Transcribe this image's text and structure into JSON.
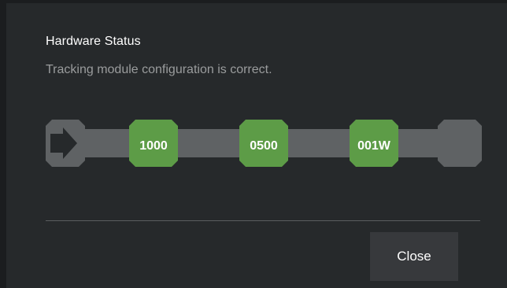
{
  "dialog": {
    "title": "Hardware Status",
    "message": "Tracking module configuration is correct.",
    "close_label": "Close"
  },
  "chain": {
    "track_color": "#5f6264",
    "module_color": "#5d9c47",
    "arrow_icon": "arrow-right-icon",
    "modules": [
      {
        "label": "1000"
      },
      {
        "label": "0500"
      },
      {
        "label": "001W"
      }
    ]
  }
}
